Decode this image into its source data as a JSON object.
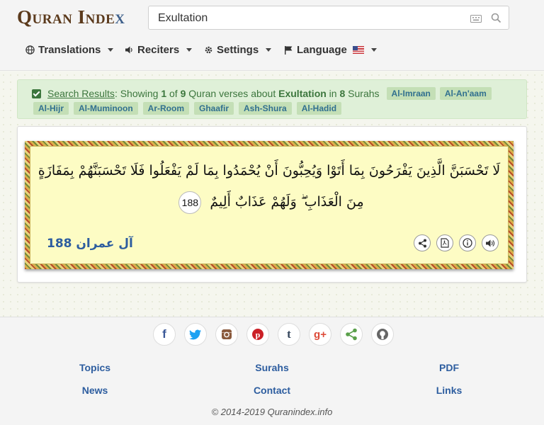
{
  "brand": {
    "logo_main": "Quran Inde",
    "logo_x": "x"
  },
  "search": {
    "value": "Exultation"
  },
  "nav": {
    "translations": "Translations",
    "reciters": "Reciters",
    "settings": "Settings",
    "language": "Language"
  },
  "results": {
    "link_label": "Search Results",
    "text_showing": ": Showing ",
    "count_shown": "1",
    "text_of": " of ",
    "count_total": "9",
    "text_about": " Quran verses about ",
    "query": "Exultation",
    "text_in": " in ",
    "surah_count": "8",
    "text_surahs": " Surahs",
    "surahs": [
      "Al-Imraan",
      "Al-An'aam",
      "Al-Hijr",
      "Al-Muminoon",
      "Ar-Room",
      "Ghaafir",
      "Ash-Shura",
      "Al-Hadid"
    ]
  },
  "verse": {
    "arabic_line1": "لَا تَحْسَبَنَّ الَّذِينَ يَفْرَحُونَ بِمَا أَتَوْا وَيُحِبُّونَ أَنْ يُحْمَدُوا بِمَا لَمْ يَفْعَلُوا فَلَا تَحْسَبَنَّهُمْ بِمَفَازَةٍ",
    "arabic_line2": "مِنَ الْعَذَابِ ۖ وَلَهُمْ عَذَابٌ أَلِيمٌ",
    "ayah_number": "188",
    "surah_name": "آل عمران",
    "surah_ayah": "188"
  },
  "footer": {
    "links": {
      "topics": "Topics",
      "surahs": "Surahs",
      "pdf": "PDF",
      "news": "News",
      "contact": "Contact",
      "links": "Links"
    },
    "copyright": "© 2014-2019 Quranindex.info"
  },
  "colors": {
    "link": "#2d5d9f",
    "success_bg": "#dff0d8",
    "success_text": "#3c763d",
    "verse_bg": "#fdfcc4"
  },
  "icons": {
    "nav": [
      "globe-icon",
      "volume-icon",
      "gear-icon",
      "flag-icon"
    ],
    "verse_actions": [
      "share-icon",
      "pdf-icon",
      "info-icon",
      "audio-icon"
    ],
    "social": [
      "facebook-icon",
      "twitter-icon",
      "instagram-icon",
      "pinterest-icon",
      "tumblr-icon",
      "google-plus-icon",
      "share-icon",
      "github-icon"
    ]
  }
}
